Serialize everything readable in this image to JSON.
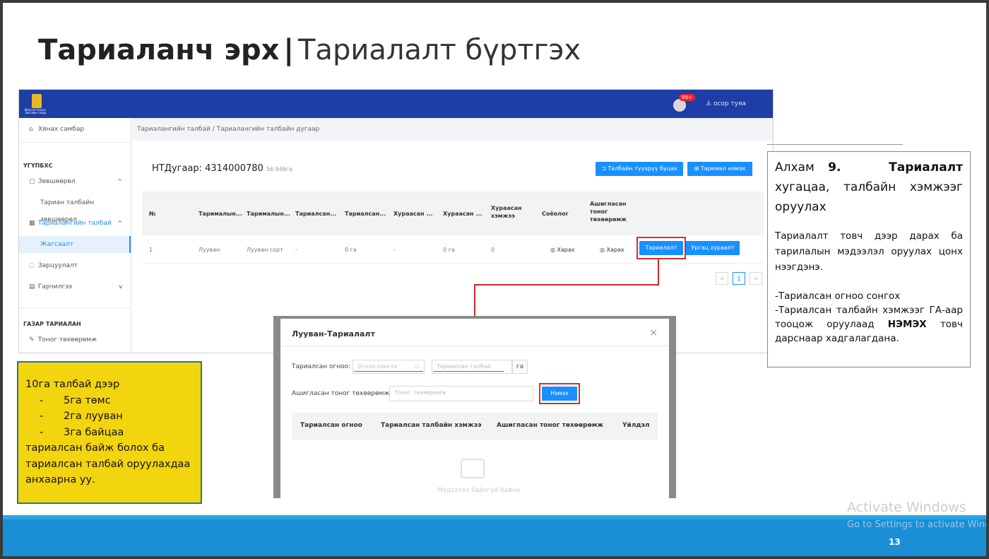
{
  "slide": {
    "title_bold": "Тариаланч эрх",
    "title_sep": "|",
    "title_rest": "Тариалалт бүртгэх",
    "page_number": "13"
  },
  "app": {
    "logo_text": "Монгол Улсын Засгийн газар",
    "notification_count": "99+",
    "user_name": "осор туяа",
    "sidebar": {
      "dashboard": "Хянах самбар",
      "section1": "ҮГҮПБХС",
      "permits": "Зөвшөөрөл",
      "land_permit": "Тариан талбайн зөвшөөрөл",
      "farmland": "Тариалангийн талбай",
      "activity": "Жагсаалт",
      "announcement": "Зарцуулалт",
      "guide": "Гарчилгээ",
      "section2": "ГАЗАР ТАРИАЛАН",
      "equipment": "Тоног төхөөрөмж"
    },
    "breadcrumb": "Тариалангийн талбай  /  Тариалангийн талбайн дугаар",
    "nt_label": "НТДугаар: 4314000780",
    "nt_area": "56.946га",
    "btn_return": "⊐ Талбайн түүхрүү буцах",
    "btn_add_crop": "⊞ Таримал нэмэх",
    "table": {
      "headers": [
        "№",
        "Тарималын...",
        "Тарималын...",
        "Тариалсан...",
        "Тариалсан...",
        "Хураасан ...",
        "Хураасан ...",
        "Хураасан хэмжээ",
        "Соёолог",
        "Ашигласан тоног төхөөрөмж"
      ],
      "row": [
        "1",
        "Лууван",
        "Лууван сорт",
        "-",
        "0 га",
        "-",
        "0 га",
        "0",
        "◎ Харах",
        "◎ Харах"
      ],
      "btn_plant": "Тариалалт",
      "btn_harvest": "Ургац хураалт"
    },
    "pager_current": "1",
    "pager_prev": "<",
    "pager_next": ">"
  },
  "modal": {
    "title": "Лууван-Тариалалт",
    "close": "×",
    "date_label": "Тариалсан огноо:",
    "date_placeholder": "Огноо сонгох",
    "field_placeholder": "Тариалсан талбай",
    "unit": "га",
    "equip_label": "Ашигласан тоног төхөөрөмж:",
    "equip_placeholder": "Тоног төхөөрөмж",
    "add_button": "Нэмэх",
    "columns": [
      "Тариалсан огноо",
      "Тариалсан талбайн хэмжээ",
      "Ашигласан тоног төхөөрөмж",
      "Үйлдэл"
    ],
    "empty_text": "Мэдээлэл байхгүй байна"
  },
  "note": {
    "step_prefix": "Алхам",
    "step_number": "9.",
    "step_title": "Тариалалт",
    "step_rest": "хугацаа, талбайн хэмжээг оруулах",
    "body": "Тариалалт товч дээр дарах ба тарилалын мэдээлэл оруулах цонх нээгдэнэ.",
    "line1": "-Тариалсан огноо сонгох",
    "line2_pre": "-Тариалсан талбайн хэмжээг ГА-аар тооцож оруулаад",
    "line2_bold": "НЭМЭХ",
    "line2_post": "товч дарснаар хадгалагдана."
  },
  "yellow": {
    "line1": "10га талбай дээр",
    "item_dash": "-",
    "item1": "5га төмс",
    "item2": "2га лууван",
    "item3": "3га байцаа",
    "line2": "тариалсан байж болох ба тариалсан талбай оруулахдаа анхаарна уу."
  },
  "watermark": {
    "line1": "Activate Windows",
    "line2": "Go to Settings to activate Windows."
  },
  "colors": {
    "app_header": "#1e3da6",
    "primary_button": "#1890ff",
    "highlight": "#d32f2f",
    "yellow_box": "#f2d40f",
    "footer": "#1a8fd6"
  }
}
